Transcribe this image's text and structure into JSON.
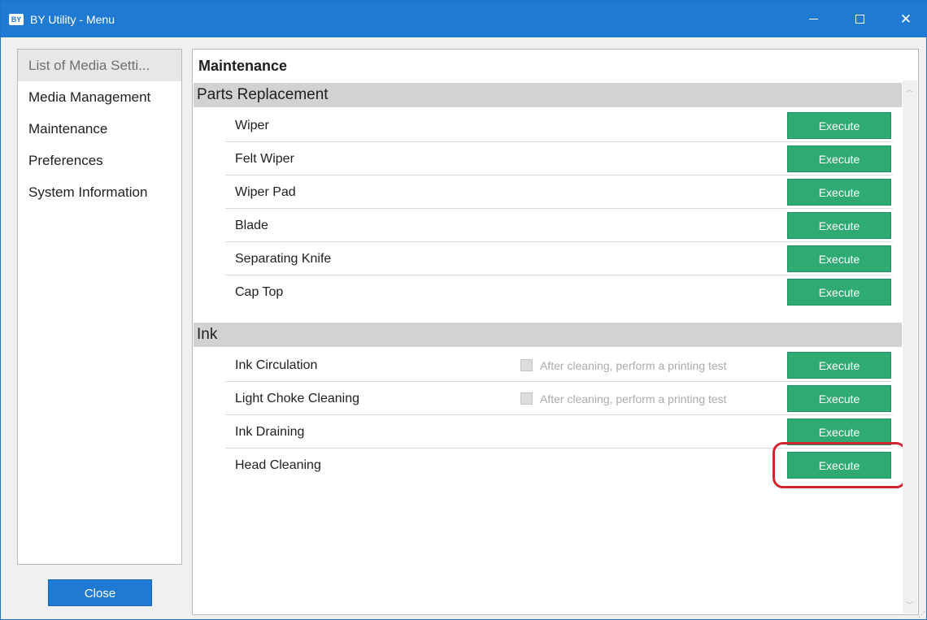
{
  "window": {
    "app_icon": "BY",
    "title": "BY Utility - Menu",
    "controls": {
      "minimize": "minimize-icon",
      "maximize": "maximize-icon",
      "close": "✕"
    }
  },
  "sidebar": {
    "items": [
      {
        "label": "List of Media Setti...",
        "selected": true
      },
      {
        "label": "Media Management"
      },
      {
        "label": "Maintenance"
      },
      {
        "label": "Preferences"
      },
      {
        "label": "System Information"
      }
    ],
    "close_label": "Close"
  },
  "main": {
    "title": "Maintenance",
    "parts": {
      "header": "Parts Replacement",
      "rows": [
        {
          "label": "Wiper",
          "button": "Execute"
        },
        {
          "label": "Felt Wiper",
          "button": "Execute"
        },
        {
          "label": "Wiper Pad",
          "button": "Execute"
        },
        {
          "label": "Blade",
          "button": "Execute"
        },
        {
          "label": "Separating Knife",
          "button": "Execute"
        },
        {
          "label": "Cap Top",
          "button": "Execute"
        }
      ]
    },
    "ink": {
      "header": "Ink",
      "rows": [
        {
          "label": "Ink Circulation",
          "checkbox": "After cleaning, perform a printing test",
          "checked": false,
          "button": "Execute"
        },
        {
          "label": "Light Choke Cleaning",
          "checkbox": "After cleaning, perform a printing test",
          "checked": false,
          "button": "Execute"
        },
        {
          "label": "Ink Draining",
          "button": "Execute"
        },
        {
          "label": "Head Cleaning",
          "button": "Execute",
          "highlighted": true
        }
      ]
    }
  },
  "colors": {
    "titlebar": "#1f7ad3",
    "execute_button": "#2eaa72",
    "highlight": "#d0262f",
    "section_header": "#d2d2d2"
  }
}
